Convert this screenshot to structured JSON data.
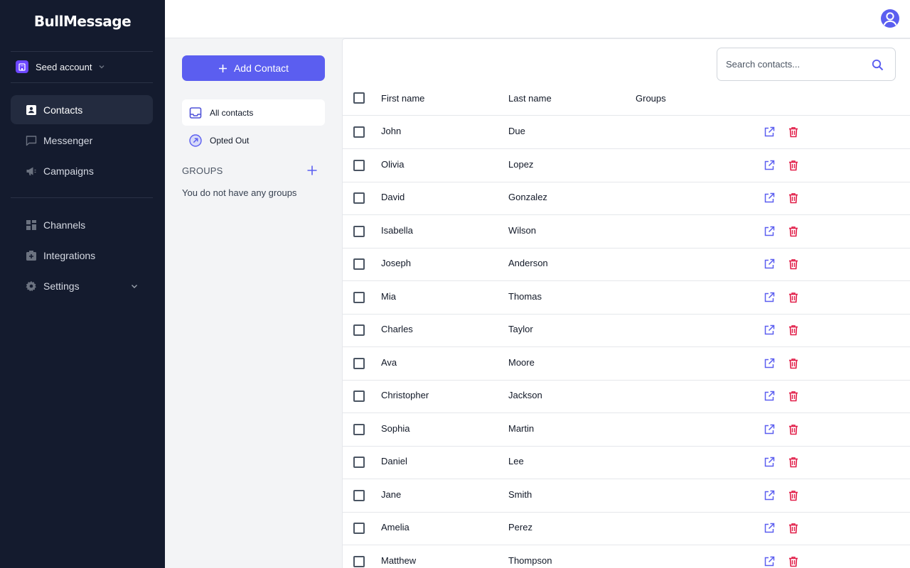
{
  "app": {
    "name": "BullMessage"
  },
  "account": {
    "name": "Seed account"
  },
  "nav": {
    "items": [
      {
        "label": "Contacts",
        "icon": "contacts-icon",
        "active": true
      },
      {
        "label": "Messenger",
        "icon": "chat-icon"
      },
      {
        "label": "Campaigns",
        "icon": "megaphone-icon"
      },
      {
        "label": "Channels",
        "icon": "channels-icon"
      },
      {
        "label": "Integrations",
        "icon": "integrations-icon"
      },
      {
        "label": "Settings",
        "icon": "gear-icon"
      }
    ]
  },
  "contacts_panel": {
    "add_button": "Add Contact",
    "filters": [
      {
        "label": "All contacts",
        "icon": "inbox-icon",
        "active": true
      },
      {
        "label": "Opted Out",
        "icon": "opt-out-icon"
      }
    ],
    "groups_label": "GROUPS",
    "groups_empty": "You do not have any groups"
  },
  "search": {
    "placeholder": "Search contacts...",
    "value": ""
  },
  "table": {
    "headers": {
      "first": "First name",
      "last": "Last name",
      "groups": "Groups"
    },
    "rows": [
      {
        "first": "John",
        "last": "Due",
        "groups": ""
      },
      {
        "first": "Olivia",
        "last": "Lopez",
        "groups": ""
      },
      {
        "first": "David",
        "last": "Gonzalez",
        "groups": ""
      },
      {
        "first": "Isabella",
        "last": "Wilson",
        "groups": ""
      },
      {
        "first": "Joseph",
        "last": "Anderson",
        "groups": ""
      },
      {
        "first": "Mia",
        "last": "Thomas",
        "groups": ""
      },
      {
        "first": "Charles",
        "last": "Taylor",
        "groups": ""
      },
      {
        "first": "Ava",
        "last": "Moore",
        "groups": ""
      },
      {
        "first": "Christopher",
        "last": "Jackson",
        "groups": ""
      },
      {
        "first": "Sophia",
        "last": "Martin",
        "groups": ""
      },
      {
        "first": "Daniel",
        "last": "Lee",
        "groups": ""
      },
      {
        "first": "Jane",
        "last": "Smith",
        "groups": ""
      },
      {
        "first": "Amelia",
        "last": "Perez",
        "groups": ""
      },
      {
        "first": "Matthew",
        "last": "Thompson",
        "groups": ""
      }
    ]
  },
  "colors": {
    "sidebar_bg": "#141b2e",
    "accent": "#5b5ef0",
    "danger": "#e11d48",
    "account_badge": "#6c47ff"
  }
}
